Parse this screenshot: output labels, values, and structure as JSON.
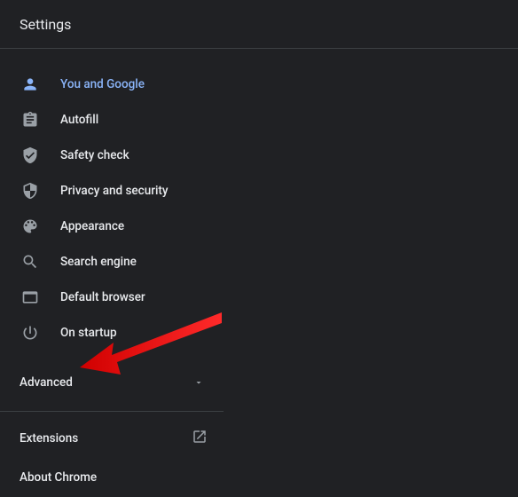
{
  "header": {
    "title": "Settings"
  },
  "nav": {
    "items": [
      {
        "label": "You and Google",
        "icon": "person-icon",
        "active": true
      },
      {
        "label": "Autofill",
        "icon": "clipboard-icon",
        "active": false
      },
      {
        "label": "Safety check",
        "icon": "shield-check-icon",
        "active": false
      },
      {
        "label": "Privacy and security",
        "icon": "shield-icon",
        "active": false
      },
      {
        "label": "Appearance",
        "icon": "palette-icon",
        "active": false
      },
      {
        "label": "Search engine",
        "icon": "search-icon",
        "active": false
      },
      {
        "label": "Default browser",
        "icon": "browser-icon",
        "active": false
      },
      {
        "label": "On startup",
        "icon": "power-icon",
        "active": false
      }
    ]
  },
  "advanced": {
    "label": "Advanced"
  },
  "extensions": {
    "label": "Extensions"
  },
  "about": {
    "label": "About Chrome"
  }
}
